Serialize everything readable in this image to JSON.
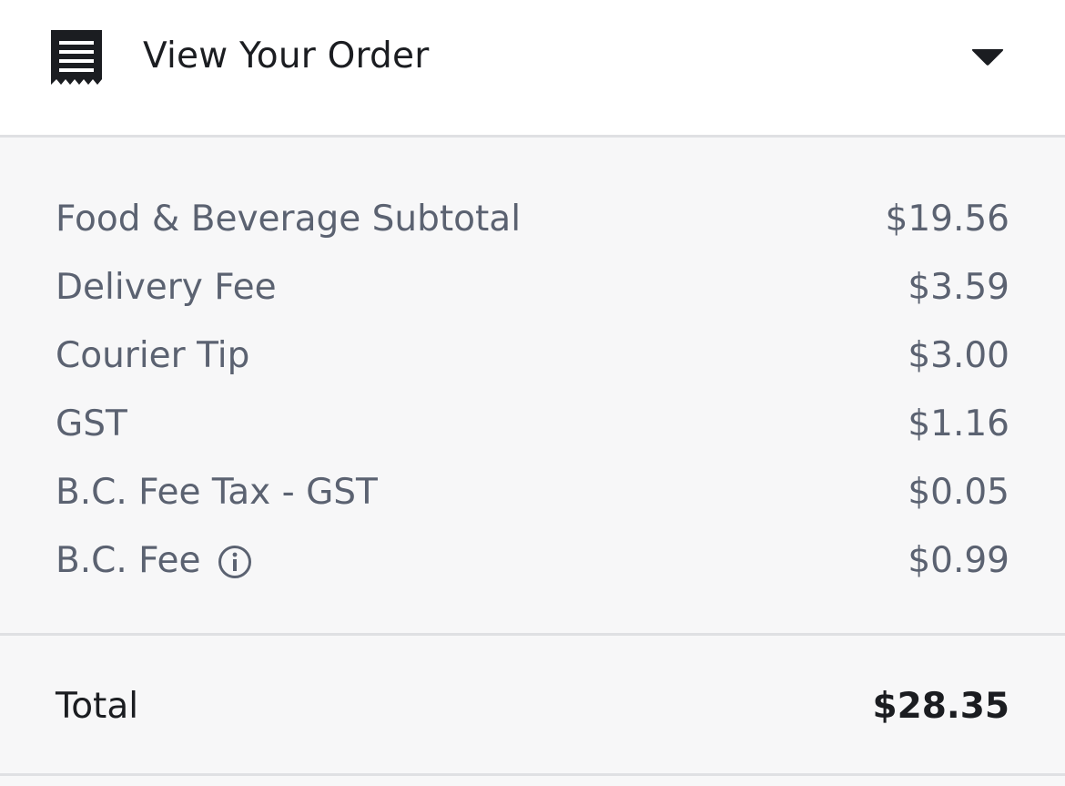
{
  "header": {
    "title": "View Your Order",
    "receipt_icon": "receipt-icon",
    "toggle_icon": "caret-down-icon"
  },
  "line_items": [
    {
      "label": "Food & Beverage Subtotal",
      "amount": "$19.56"
    },
    {
      "label": "Delivery Fee",
      "amount": "$3.59"
    },
    {
      "label": "Courier Tip",
      "amount": "$3.00"
    },
    {
      "label": "GST",
      "amount": "$1.16"
    },
    {
      "label": "B.C. Fee Tax - GST",
      "amount": "$0.05"
    },
    {
      "label": "B.C. Fee",
      "amount": "$0.99",
      "info_icon": "info-icon"
    }
  ],
  "total": {
    "label": "Total",
    "amount": "$28.35"
  },
  "colors": {
    "primary_text": "#1b1d21",
    "secondary_text": "#5b6271",
    "panel_background": "#f7f7f8",
    "divider": "#dfe0e3"
  }
}
